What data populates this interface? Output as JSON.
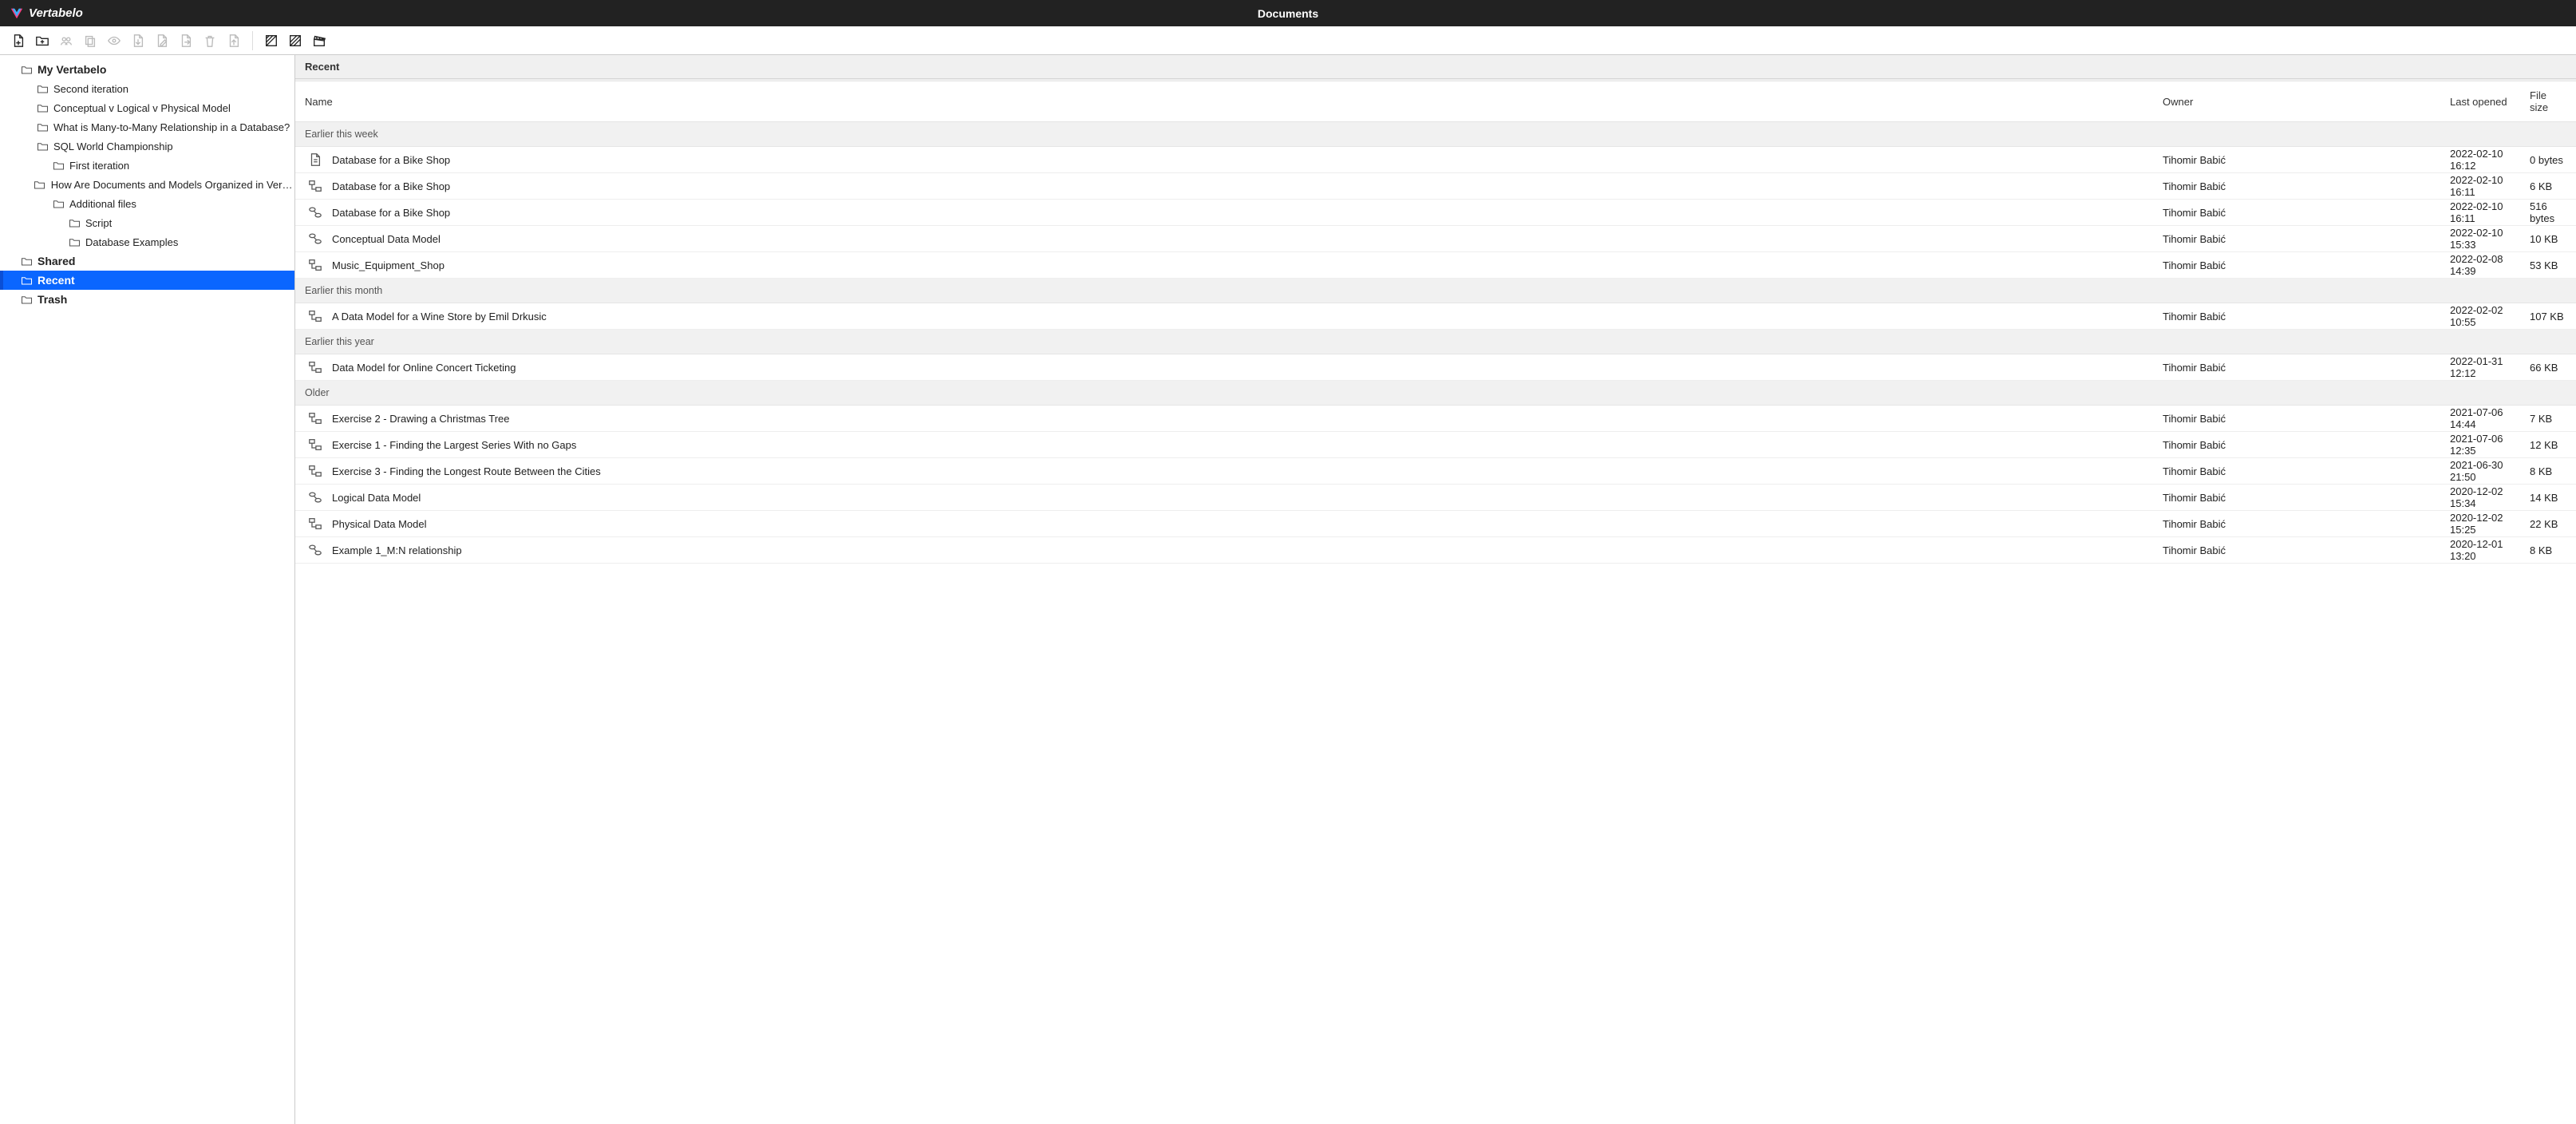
{
  "app": {
    "brand": "Vertabelo",
    "title": "Documents"
  },
  "toolbar": {
    "items": [
      {
        "name": "new-document-button",
        "icon": "file-plus",
        "enabled": true
      },
      {
        "name": "new-folder-button",
        "icon": "folder-plus",
        "enabled": true
      },
      {
        "name": "share-button",
        "icon": "people",
        "enabled": false
      },
      {
        "name": "duplicate-button",
        "icon": "copy",
        "enabled": false
      },
      {
        "name": "preview-button",
        "icon": "eye",
        "enabled": false
      },
      {
        "name": "export-button",
        "icon": "file-export",
        "enabled": false
      },
      {
        "name": "rename-button",
        "icon": "file-edit",
        "enabled": false
      },
      {
        "name": "move-button",
        "icon": "file-move",
        "enabled": false
      },
      {
        "name": "delete-button",
        "icon": "trash",
        "enabled": false
      },
      {
        "name": "import-button",
        "icon": "file-import",
        "enabled": false
      },
      {
        "sep": true
      },
      {
        "name": "view-logical-button",
        "icon": "hatch-left",
        "enabled": true
      },
      {
        "name": "view-physical-button",
        "icon": "hatch-mid",
        "enabled": true
      },
      {
        "name": "view-movie-button",
        "icon": "clapper",
        "enabled": true
      }
    ]
  },
  "sidebar": {
    "nodes": [
      {
        "depth": 0,
        "icon": "folder",
        "label": "My Vertabelo",
        "bold": true
      },
      {
        "depth": 1,
        "icon": "folder",
        "label": "Second iteration"
      },
      {
        "depth": 1,
        "icon": "folder",
        "label": "Conceptual v Logical v Physical Model"
      },
      {
        "depth": 1,
        "icon": "folder",
        "label": "What is Many-to-Many Relationship in a Database?"
      },
      {
        "depth": 1,
        "icon": "folder",
        "label": "SQL World Championship"
      },
      {
        "depth": 2,
        "icon": "folder",
        "label": "First iteration"
      },
      {
        "depth": 1,
        "icon": "folder",
        "label": "How Are Documents and Models Organized in Vertabelo?"
      },
      {
        "depth": 2,
        "icon": "folder",
        "label": "Additional files"
      },
      {
        "depth": 3,
        "icon": "folder",
        "label": "Script"
      },
      {
        "depth": 3,
        "icon": "folder",
        "label": "Database Examples"
      },
      {
        "depth": 0,
        "icon": "folder",
        "label": "Shared",
        "bold": true
      },
      {
        "depth": 0,
        "icon": "folder",
        "label": "Recent",
        "bold": true,
        "selected": true
      },
      {
        "depth": 0,
        "icon": "folder",
        "label": "Trash",
        "bold": true
      }
    ]
  },
  "content": {
    "title": "Recent",
    "columns": {
      "name": "Name",
      "owner": "Owner",
      "opened": "Last opened",
      "size": "File size"
    },
    "groups": [
      {
        "label": "Earlier this week",
        "items": [
          {
            "icon": "doc",
            "name": "Database for a Bike Shop",
            "owner": "Tihomir Babić",
            "opened": "2022-02-10 16:12",
            "size": "0 bytes"
          },
          {
            "icon": "physical",
            "name": "Database for a Bike Shop",
            "owner": "Tihomir Babić",
            "opened": "2022-02-10 16:11",
            "size": "6 KB"
          },
          {
            "icon": "logical",
            "name": "Database for a Bike Shop",
            "owner": "Tihomir Babić",
            "opened": "2022-02-10 16:11",
            "size": "516 bytes"
          },
          {
            "icon": "logical",
            "name": "Conceptual Data Model",
            "owner": "Tihomir Babić",
            "opened": "2022-02-10 15:33",
            "size": "10 KB"
          },
          {
            "icon": "physical",
            "name": "Music_Equipment_Shop",
            "owner": "Tihomir Babić",
            "opened": "2022-02-08 14:39",
            "size": "53 KB"
          }
        ]
      },
      {
        "label": "Earlier this month",
        "items": [
          {
            "icon": "physical",
            "name": "A Data Model for a Wine Store by Emil Drkusic",
            "owner": "Tihomir Babić",
            "opened": "2022-02-02 10:55",
            "size": "107 KB"
          }
        ]
      },
      {
        "label": "Earlier this year",
        "items": [
          {
            "icon": "physical",
            "name": "Data Model for Online Concert Ticketing",
            "owner": "Tihomir Babić",
            "opened": "2022-01-31 12:12",
            "size": "66 KB"
          }
        ]
      },
      {
        "label": "Older",
        "items": [
          {
            "icon": "physical",
            "name": "Exercise 2 - Drawing a Christmas Tree",
            "owner": "Tihomir Babić",
            "opened": "2021-07-06 14:44",
            "size": "7 KB"
          },
          {
            "icon": "physical",
            "name": "Exercise 1 - Finding the Largest Series With no Gaps",
            "owner": "Tihomir Babić",
            "opened": "2021-07-06 12:35",
            "size": "12 KB"
          },
          {
            "icon": "physical",
            "name": "Exercise 3 - Finding the Longest Route Between the Cities",
            "owner": "Tihomir Babić",
            "opened": "2021-06-30 21:50",
            "size": "8 KB"
          },
          {
            "icon": "logical",
            "name": "Logical Data Model",
            "owner": "Tihomir Babić",
            "opened": "2020-12-02 15:34",
            "size": "14 KB"
          },
          {
            "icon": "physical",
            "name": "Physical Data Model",
            "owner": "Tihomir Babić",
            "opened": "2020-12-02 15:25",
            "size": "22 KB"
          },
          {
            "icon": "logical",
            "name": "Example 1_M:N relationship",
            "owner": "Tihomir Babić",
            "opened": "2020-12-01 13:20",
            "size": "8 KB"
          }
        ]
      }
    ]
  }
}
